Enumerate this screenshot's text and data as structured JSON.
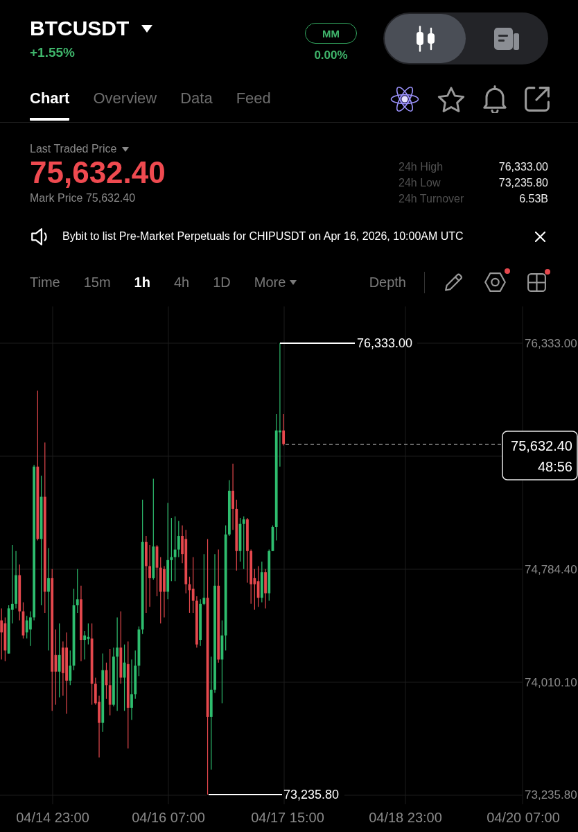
{
  "header": {
    "symbol": "BTCUSDT",
    "change": "+1.55%",
    "mm": {
      "label": "MM",
      "value": "0.00%"
    },
    "view_toggle": [
      {
        "kind": "chart",
        "selected": true
      },
      {
        "kind": "info",
        "selected": false
      }
    ]
  },
  "tabs": [
    {
      "label": "Chart",
      "selected": true
    },
    {
      "label": "Overview",
      "selected": false
    },
    {
      "label": "Data",
      "selected": false
    },
    {
      "label": "Feed",
      "selected": false
    }
  ],
  "price": {
    "label": "Last Traded Price",
    "last": "75,632.40",
    "mark": "Mark Price 75,632.40",
    "stats": [
      {
        "label": "24h High",
        "value": "76,333.00"
      },
      {
        "label": "24h Low",
        "value": "73,235.80"
      },
      {
        "label": "24h Turnover",
        "value": "6.53B"
      }
    ]
  },
  "announcement": {
    "text": "Bybit to list Pre-Market Perpetuals for CHIPUSDT on Apr 16, 2026, 10:00AM UTC"
  },
  "intervals": [
    {
      "label": "Time",
      "selected": false
    },
    {
      "label": "15m",
      "selected": false
    },
    {
      "label": "1h",
      "selected": true
    },
    {
      "label": "4h",
      "selected": false
    },
    {
      "label": "1D",
      "selected": false
    }
  ],
  "more": {
    "label": "More"
  },
  "depth": {
    "label": "Depth",
    "selected": false
  },
  "chart_tools": [
    {
      "kind": "draw",
      "badge": false
    },
    {
      "kind": "indicators",
      "badge": true
    },
    {
      "kind": "layout",
      "badge": true
    }
  ],
  "chart": {
    "high_label": "76,333.00",
    "low_label": "73,235.80",
    "price_tag": {
      "price": "75,632.40",
      "countdown": "48:56"
    },
    "y_axis_labels": [
      "76,333.00",
      "74,784.40",
      "74,010.10",
      "73,235.80"
    ],
    "x_axis_labels": [
      "04/14 23:00",
      "04/16 07:00",
      "04/17 15:00",
      "04/18 23:00",
      "04/20 07:00"
    ]
  }
}
